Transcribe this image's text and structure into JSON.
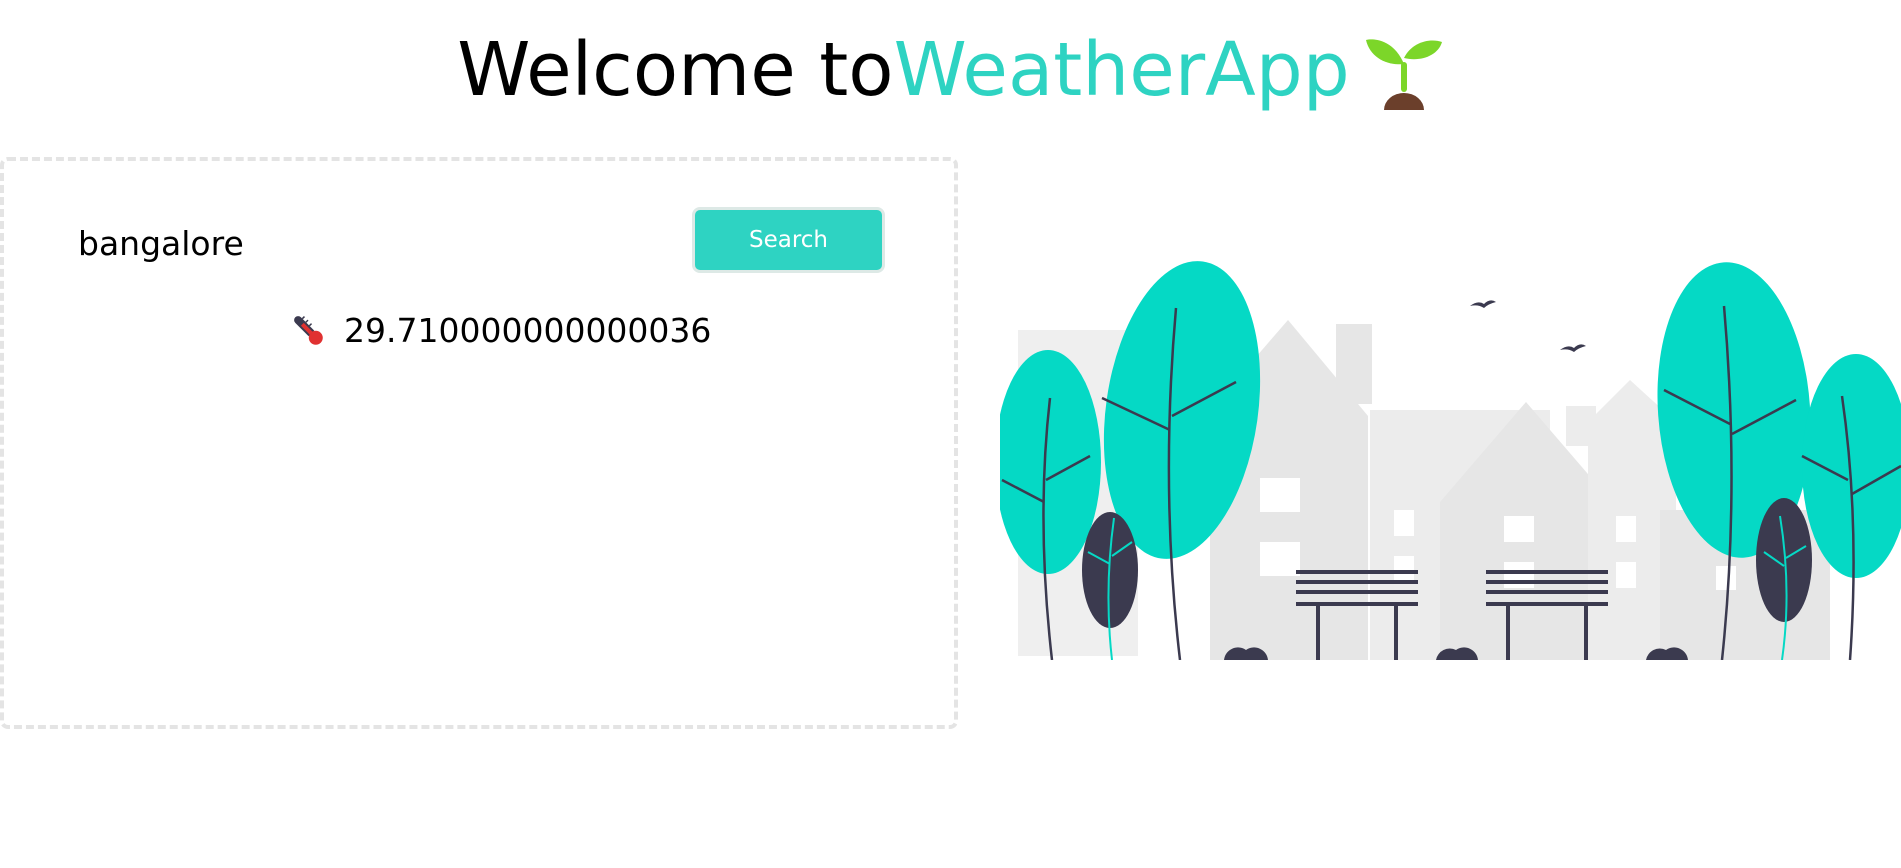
{
  "header": {
    "welcome_text": "Welcome to",
    "brand_text": "WeatherApp",
    "sprout_icon": "sprout-icon",
    "brand_color": "#2ed3c2"
  },
  "search": {
    "input_value": "bangalore",
    "button_label": "Search",
    "button_color": "#2ed3c2"
  },
  "result": {
    "temperature": "29.710000000000036",
    "icon": "thermometer-icon"
  },
  "illustration": {
    "icon": "park-city-illustration",
    "tree_color": "#05d9c5",
    "dark_color": "#3b3a4f"
  }
}
